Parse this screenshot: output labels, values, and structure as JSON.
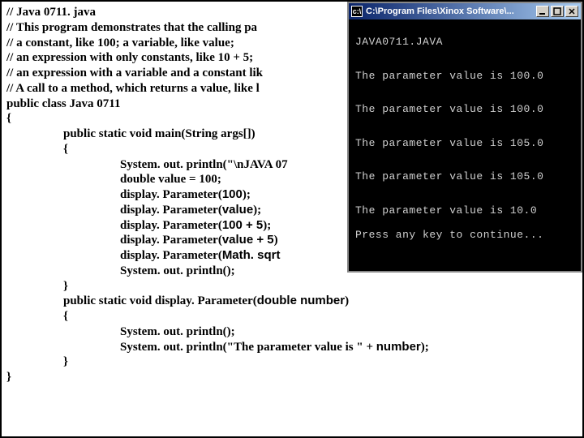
{
  "code": {
    "c1": "// Java 0711. java",
    "c2": "// This program demonstrates that the calling pa",
    "c3": "// a constant, like 100;   a variable, like value;",
    "c4": "// an expression with only constants, like 10 + 5;",
    "c5": "// an expression with a variable and a constant lik",
    "c6": "// A call to a method, which returns a value, like l",
    "c7": "public class Java 0711",
    "c8": "{",
    "c9": "public static void main(String args[])",
    "c10": "{",
    "c11": "System. out. println(\"\\nJAVA 07",
    "c12": "double value = 100;",
    "c13a": "display. Parameter(",
    "arg100": "100",
    "c13b": ");",
    "c14a": "display. Parameter(",
    "argvalue": "value",
    "c14b": ");",
    "c15a": "display. Parameter(",
    "arg100p5": "100 + 5",
    "c15b": ");",
    "c16a": "display. Parameter(",
    "argvaluep5": "value + 5",
    "c16b": ")",
    "c17a": "display. Parameter(",
    "argsqrt": "Math. sqrt",
    "c18": "System. out. println();",
    "c19": "}",
    "c20a": "public static void display. Parameter(",
    "argdoublenum": "double number",
    "c20b": ")",
    "c21": "{",
    "c22": "System. out. println();",
    "c23a": "System. out. println(\"The parameter value is \" + ",
    "argnumber": "number",
    "c23b": ");",
    "c24": "}",
    "c25": "}"
  },
  "console": {
    "title": "C:\\Program Files\\Xinox Software\\...",
    "out_header": "JAVA0711.JAVA",
    "line1": "The parameter value is 100.0",
    "line2": "The parameter value is 100.0",
    "line3": "The parameter value is 105.0",
    "line4": "The parameter value is 105.0",
    "line5": "The parameter value is 10.0",
    "press": "Press any key to continue..."
  }
}
